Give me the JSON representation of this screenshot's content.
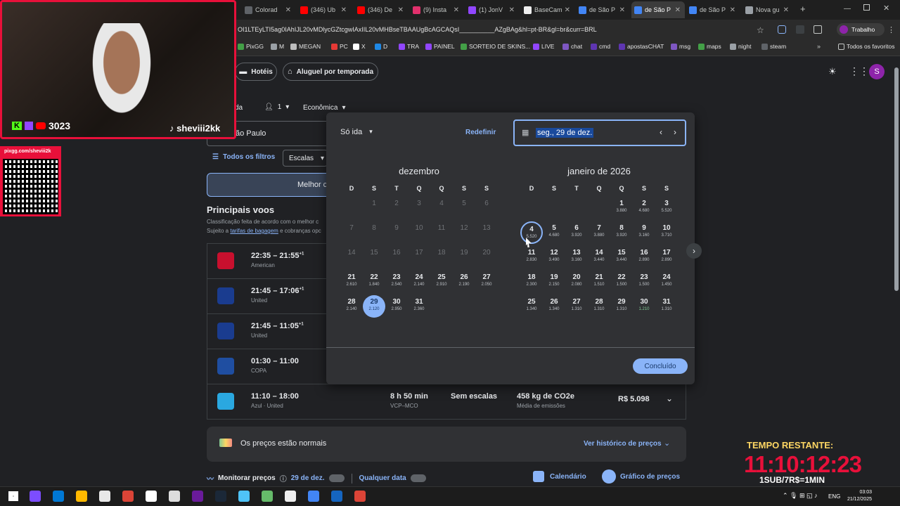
{
  "browser": {
    "tabs": [
      {
        "label": "Colorad",
        "color": "#5f6368"
      },
      {
        "label": "(346) Ub",
        "color": "#ff0000"
      },
      {
        "label": "(346) De",
        "color": "#ff0000"
      },
      {
        "label": "(9) Insta",
        "color": "#e1306c"
      },
      {
        "label": "(1) JonV",
        "color": "#9146ff"
      },
      {
        "label": "BaseCam",
        "color": "#eeeeee"
      },
      {
        "label": "de São P",
        "color": "#4285f4"
      },
      {
        "label": "de São P",
        "color": "#4285f4"
      },
      {
        "label": "de São P",
        "color": "#4285f4"
      },
      {
        "label": "Nova gu",
        "color": "#9aa0a6"
      }
    ],
    "new_tab": "+",
    "url": "OI1LTEyLTI5ag0IAhIJL20vMDlycGZtcgwIAxIIL20vMHBseTBAAUgBcAGCAQsI__________AZgBAg&hl=pt-BR&gl=br&curr=BRL",
    "profile_label": "Trabalho",
    "bookmarks": [
      "PixGG",
      "M",
      "MEGAN",
      "PC",
      "X",
      "D",
      "TRA",
      "PAINEL",
      "SORTEIO DE SKINS...",
      "LIVE",
      "chat",
      "cmd",
      "apostasCHAT",
      "msg",
      "maps",
      "night",
      "steam"
    ],
    "all_bookmarks": "Todos os favoritos"
  },
  "header": {
    "hotels": "Hotéis",
    "rentals": "Aluguel por temporada"
  },
  "search": {
    "trip_suffix": "da",
    "passengers": "1",
    "cabin": "Econômica",
    "origin_partial": "ão Paulo",
    "all_filters": "Todos os filtros",
    "stops_filter": "Escalas",
    "best_tab": "Melhor c"
  },
  "results": {
    "heading": "Principais voos",
    "sub1": "Classificação feita de acordo com o melhor c",
    "sub2_pre": "Sujeito a ",
    "sub2_link": "tarifas de bagagem",
    "sub2_post": " e cobranças opc",
    "flights": [
      {
        "time": "22:35 – 21:55",
        "plus": "+1",
        "airline": "American",
        "logo": "#c8102e"
      },
      {
        "time": "21:45 – 17:06",
        "plus": "+1",
        "airline": "United",
        "logo": "#1a3c8f"
      },
      {
        "time": "21:45 – 11:05",
        "plus": "+1",
        "airline": "United",
        "logo": "#1a3c8f"
      },
      {
        "time": "01:30 – 11:00",
        "plus": "",
        "airline": "COPA",
        "logo": "#1f4ea1"
      },
      {
        "time": "11:10 – 18:00",
        "plus": "",
        "airline": "Azul · United",
        "logo": "#2aa8e0",
        "duration": "8 h 50 min",
        "route": "VCP–MCO",
        "stops": "Sem escalas",
        "co2": "458 kg de CO2e",
        "co2_sub": "Média de emissões",
        "price": "R$ 5.098"
      }
    ],
    "price_status": "Os preços estão normais",
    "price_history": "Ver histórico de preços",
    "monitor": "Monitorar preços",
    "monitor_date": "29 de dez.",
    "any_date": "Qualquer data",
    "calendar": "Calendário",
    "price_graph": "Gráfico de preços"
  },
  "calendar": {
    "trip_type": "Só ida",
    "reset": "Redefinir",
    "date_value": "seg., 29 de dez.",
    "done": "Concluído",
    "weekdays": [
      "D",
      "S",
      "T",
      "Q",
      "Q",
      "S",
      "S"
    ],
    "months": [
      {
        "title": "dezembro",
        "offset": 1,
        "days": [
          [
            "1",
            ""
          ],
          [
            "2",
            ""
          ],
          [
            "3",
            ""
          ],
          [
            "4",
            ""
          ],
          [
            "5",
            ""
          ],
          [
            "6",
            ""
          ],
          [
            "7",
            ""
          ],
          [
            "8",
            ""
          ],
          [
            "9",
            ""
          ],
          [
            "10",
            ""
          ],
          [
            "11",
            ""
          ],
          [
            "12",
            ""
          ],
          [
            "13",
            ""
          ],
          [
            "14",
            ""
          ],
          [
            "15",
            ""
          ],
          [
            "16",
            ""
          ],
          [
            "17",
            ""
          ],
          [
            "18",
            ""
          ],
          [
            "19",
            ""
          ],
          [
            "20",
            ""
          ],
          [
            "21",
            "2.610"
          ],
          [
            "22",
            "1.840"
          ],
          [
            "23",
            "2.540"
          ],
          [
            "24",
            "2.140"
          ],
          [
            "25",
            "2.910"
          ],
          [
            "26",
            "2.190"
          ],
          [
            "27",
            "2.050"
          ],
          [
            "28",
            "2.140"
          ],
          [
            "29",
            "2.120"
          ],
          [
            "30",
            "2.950"
          ],
          [
            "31",
            "2.360"
          ]
        ],
        "past_until": 20,
        "selected": 29
      },
      {
        "title": "janeiro de 2026",
        "offset": 4,
        "days": [
          [
            "1",
            "3.880"
          ],
          [
            "2",
            "4.680"
          ],
          [
            "3",
            "5.520"
          ],
          [
            "4",
            "5.520"
          ],
          [
            "5",
            "4.680"
          ],
          [
            "6",
            "3.920"
          ],
          [
            "7",
            "3.880"
          ],
          [
            "8",
            "3.920"
          ],
          [
            "9",
            "3.160"
          ],
          [
            "10",
            "3.710"
          ],
          [
            "11",
            "2.830"
          ],
          [
            "12",
            "3.490"
          ],
          [
            "13",
            "3.160"
          ],
          [
            "14",
            "3.440"
          ],
          [
            "15",
            "3.440"
          ],
          [
            "16",
            "2.890"
          ],
          [
            "17",
            "2.890"
          ],
          [
            "18",
            "2.300"
          ],
          [
            "19",
            "2.150"
          ],
          [
            "20",
            "2.080"
          ],
          [
            "21",
            "1.510"
          ],
          [
            "22",
            "1.500"
          ],
          [
            "23",
            "1.500"
          ],
          [
            "24",
            "1.450"
          ],
          [
            "25",
            "1.340"
          ],
          [
            "26",
            "1.340"
          ],
          [
            "27",
            "1.310"
          ],
          [
            "28",
            "1.310"
          ],
          [
            "29",
            "1.310"
          ],
          [
            "30",
            "1.210"
          ],
          [
            "31",
            "1.310"
          ]
        ],
        "hover": 4,
        "cheap": [
          30
        ]
      }
    ]
  },
  "overlay": {
    "cam_count": "3023",
    "cam_handle": "sheviii2kk",
    "pix_url": "pixgg.com/sheviii2k",
    "timer_label": "TEMPO RESTANTE:",
    "timer_value": "11:10:12:23",
    "timer_rule": "1SUB/7R$=1MIN"
  },
  "taskbar": {
    "time": "03:03",
    "date": "21/12/2025",
    "lang": "ENG"
  }
}
